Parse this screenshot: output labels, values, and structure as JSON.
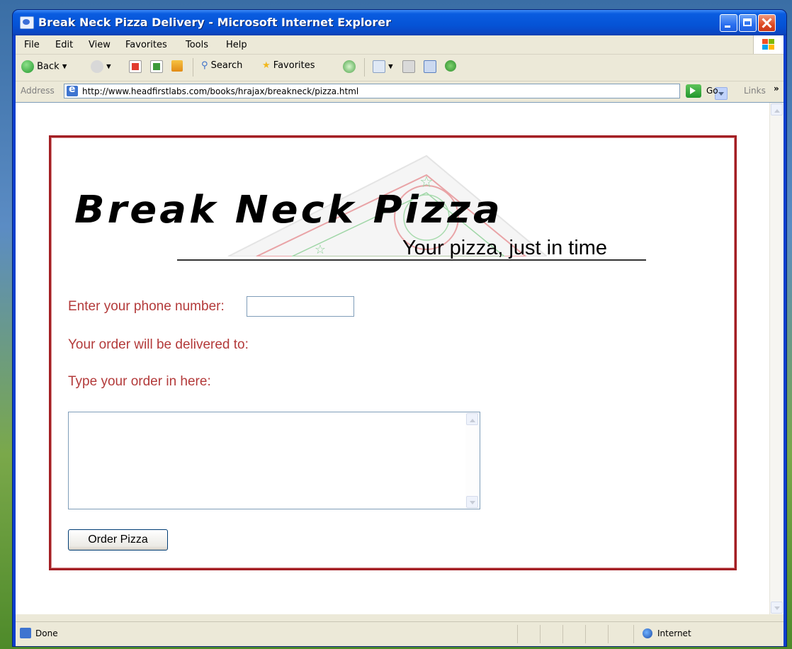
{
  "window": {
    "title": "Break Neck Pizza Delivery - Microsoft Internet Explorer"
  },
  "menu": {
    "items": [
      "File",
      "Edit",
      "View",
      "Favorites",
      "Tools",
      "Help"
    ]
  },
  "toolbar": {
    "back_label": "Back",
    "search_label": "Search",
    "favorites_label": "Favorites"
  },
  "address": {
    "label": "Address",
    "url": "http://www.headfirstlabs.com/books/hrajax/breakneck/pizza.html",
    "go_label": "Go",
    "links_label": "Links",
    "more": "»"
  },
  "page": {
    "logo_text": "Break Neck Pizza",
    "tagline": "Your pizza, just in time",
    "phone_label": "Enter your phone number:",
    "phone_value": "",
    "delivery_label": "Your order will be delivered to:",
    "order_label": "Type your order in here:",
    "order_value": "",
    "order_button": "Order Pizza",
    "border_color": "#a31f24",
    "label_color": "#b33a3a"
  },
  "status": {
    "text": "Done",
    "zone": "Internet"
  }
}
